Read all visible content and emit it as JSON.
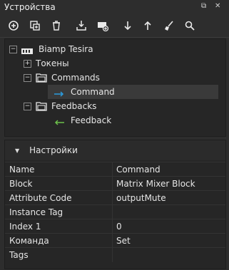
{
  "window": {
    "title": "Устройства"
  },
  "tree": {
    "root": "Biamp Tesira",
    "tokens": "Токены",
    "commands": "Commands",
    "command": "Command",
    "feedbacks": "Feedbacks",
    "feedback": "Feedback"
  },
  "properties": {
    "header": "Настройки",
    "rows": [
      {
        "key": "Name",
        "value": "Command"
      },
      {
        "key": "Block",
        "value": "Matrix Mixer Block"
      },
      {
        "key": "Attribute Code",
        "value": "outputMute"
      },
      {
        "key": "Instance Tag",
        "value": ""
      },
      {
        "key": "Index 1",
        "value": "0"
      },
      {
        "key": "Команда",
        "value": "Set"
      },
      {
        "key": "Tags",
        "value": ""
      }
    ]
  },
  "colors": {
    "command_arrow": "#2b9de0",
    "feedback_arrow": "#6cc04a"
  }
}
